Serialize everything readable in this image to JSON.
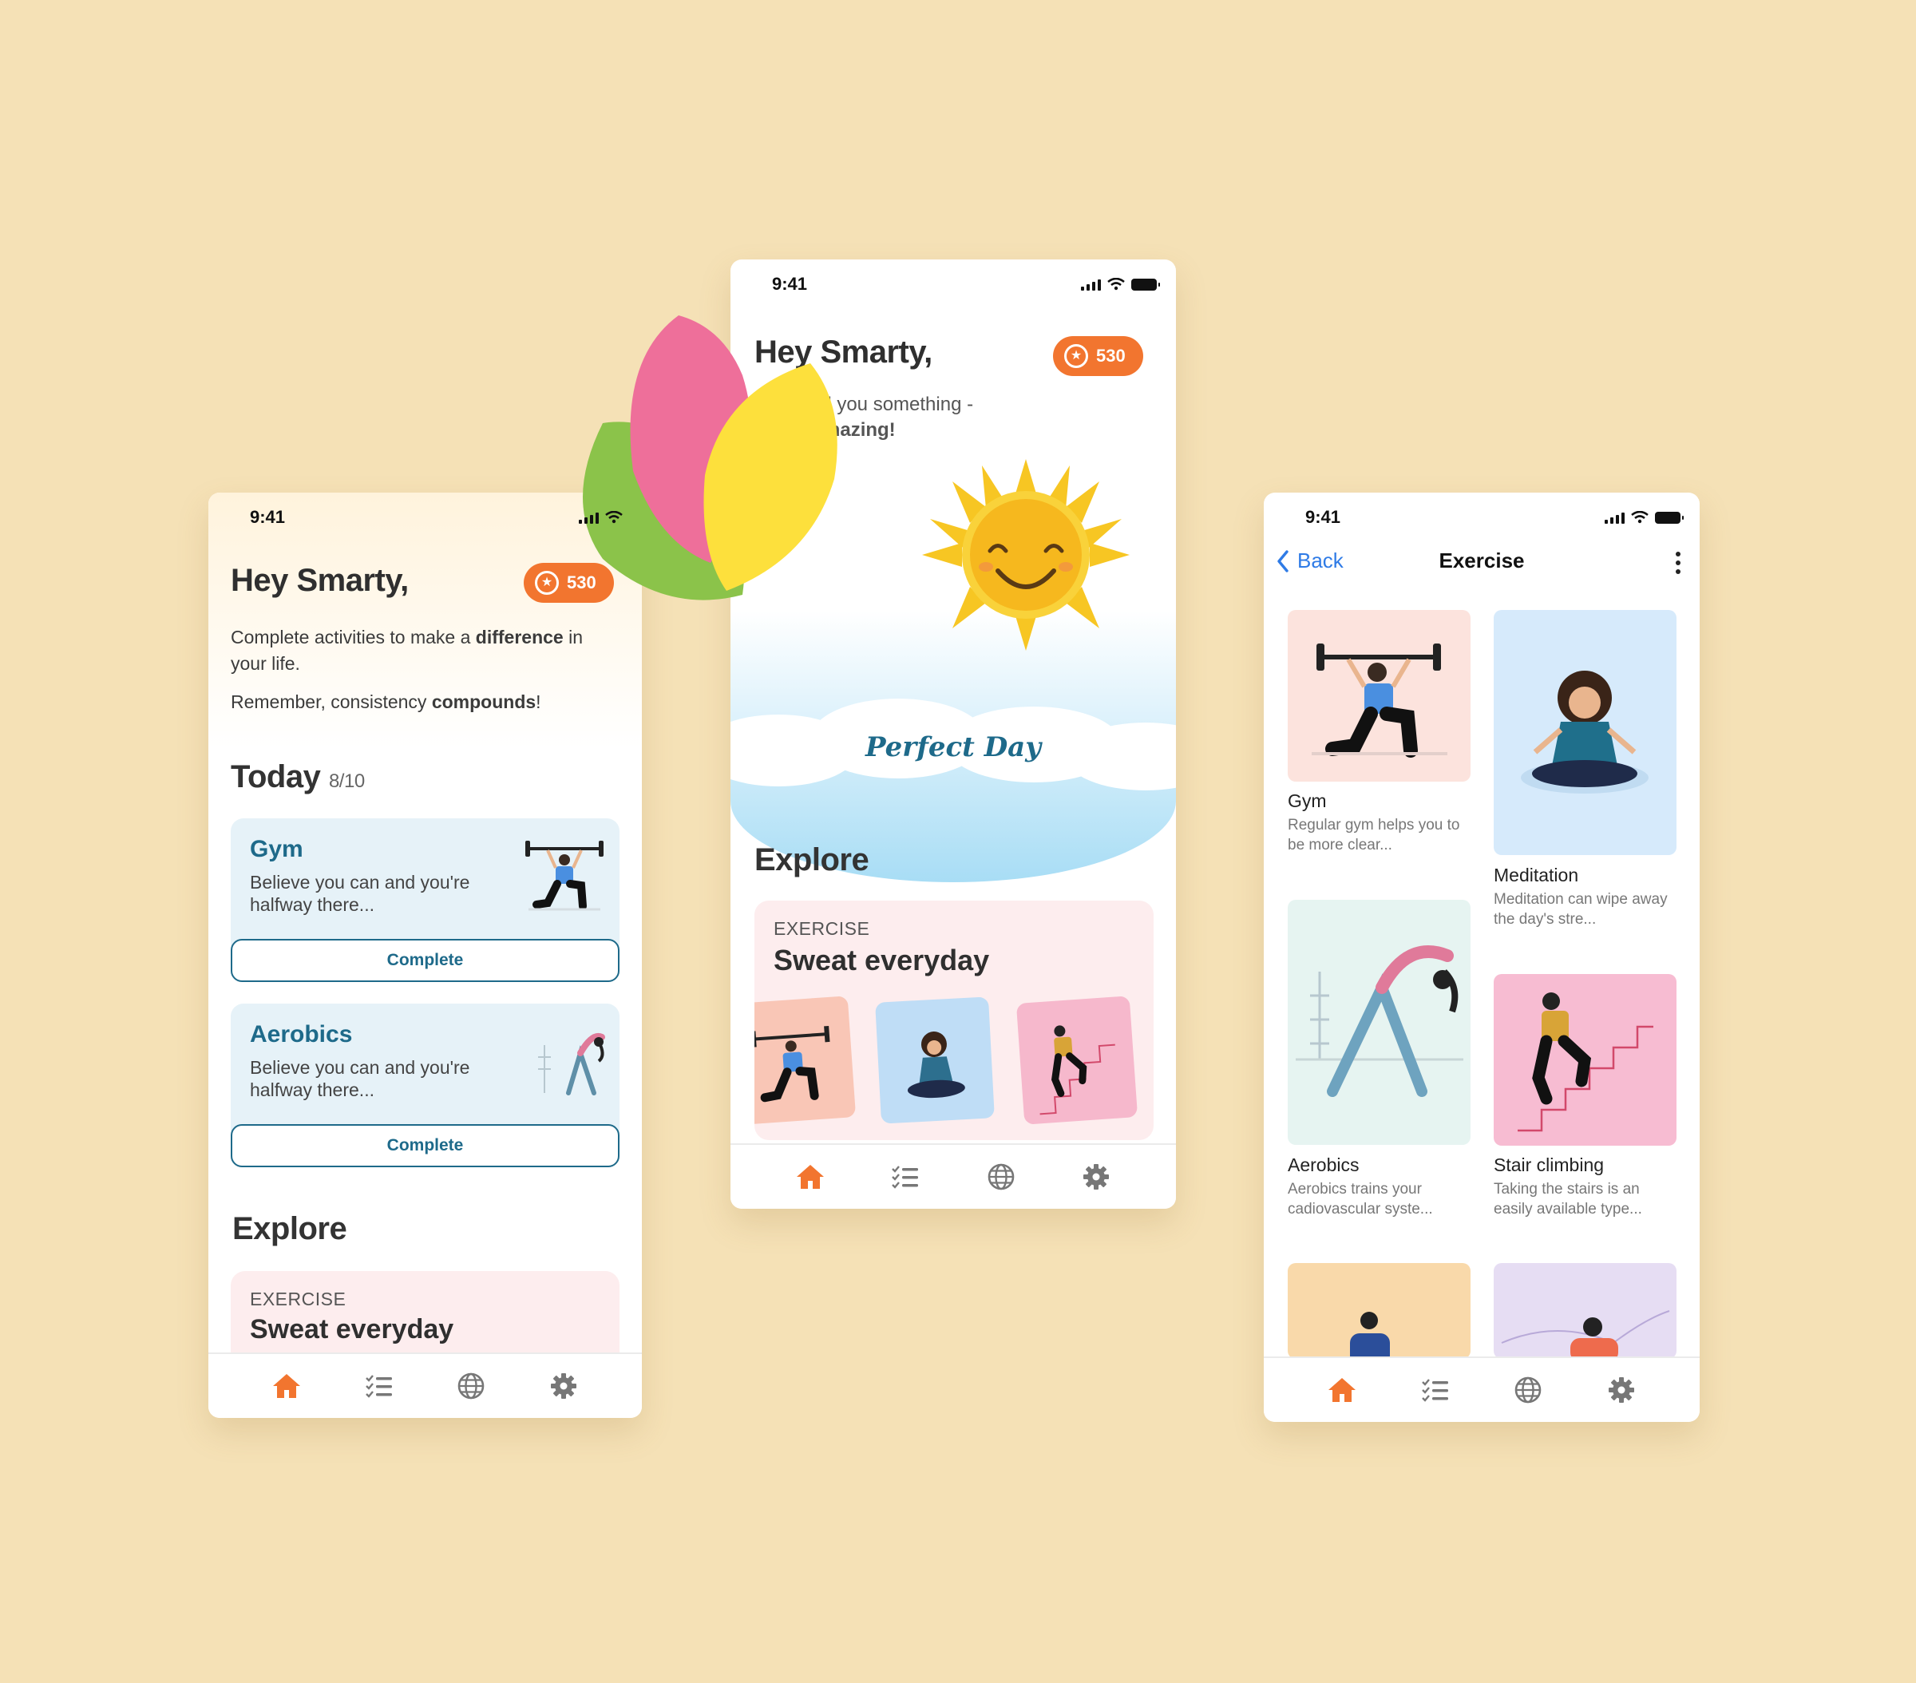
{
  "status": {
    "time": "9:41"
  },
  "user": {
    "greeting": "Hey Smarty,",
    "points": "530"
  },
  "colors": {
    "background": "#F5E1B6",
    "accent_orange": "#F2752F",
    "teal": "#1E6A8A",
    "link_blue": "#2F7BE6"
  },
  "left": {
    "intro_1a": "Complete activities to make a ",
    "intro_1b": "difference",
    "intro_1c": " in your life.",
    "intro_2a": "Remember, consistency ",
    "intro_2b": "compounds",
    "intro_2c": "!",
    "today_label": "Today",
    "today_count": "8/10",
    "activities": [
      {
        "title": "Gym",
        "desc": "Believe you can and you're halfway there...",
        "button": "Complete"
      },
      {
        "title": "Aerobics",
        "desc": "Believe you can and you're halfway there...",
        "button": "Complete"
      }
    ],
    "explore_label": "Explore",
    "explore_card": {
      "category": "EXERCISE",
      "title": "Sweat everyday"
    }
  },
  "center": {
    "sub_line_1": "ll you something -",
    "sub_line_2": "mazing!",
    "banner": "Perfect Day",
    "explore_label": "Explore",
    "explore_card": {
      "category": "EXERCISE",
      "title": "Sweat everyday"
    }
  },
  "right": {
    "back_label": "Back",
    "title": "Exercise",
    "items": [
      {
        "title": "Gym",
        "desc": "Regular gym helps you to be more clear..."
      },
      {
        "title": "Meditation",
        "desc": "Meditation can wipe away the day's stre..."
      },
      {
        "title": "Aerobics",
        "desc": "Aerobics trains your cadiovascular syste..."
      },
      {
        "title": "Stair climbing",
        "desc": "Taking the stairs is an easily available type..."
      }
    ]
  },
  "tabs": [
    {
      "name": "home-icon",
      "active": true
    },
    {
      "name": "checklist-icon",
      "active": false
    },
    {
      "name": "globe-icon",
      "active": false
    },
    {
      "name": "gear-icon",
      "active": false
    }
  ]
}
